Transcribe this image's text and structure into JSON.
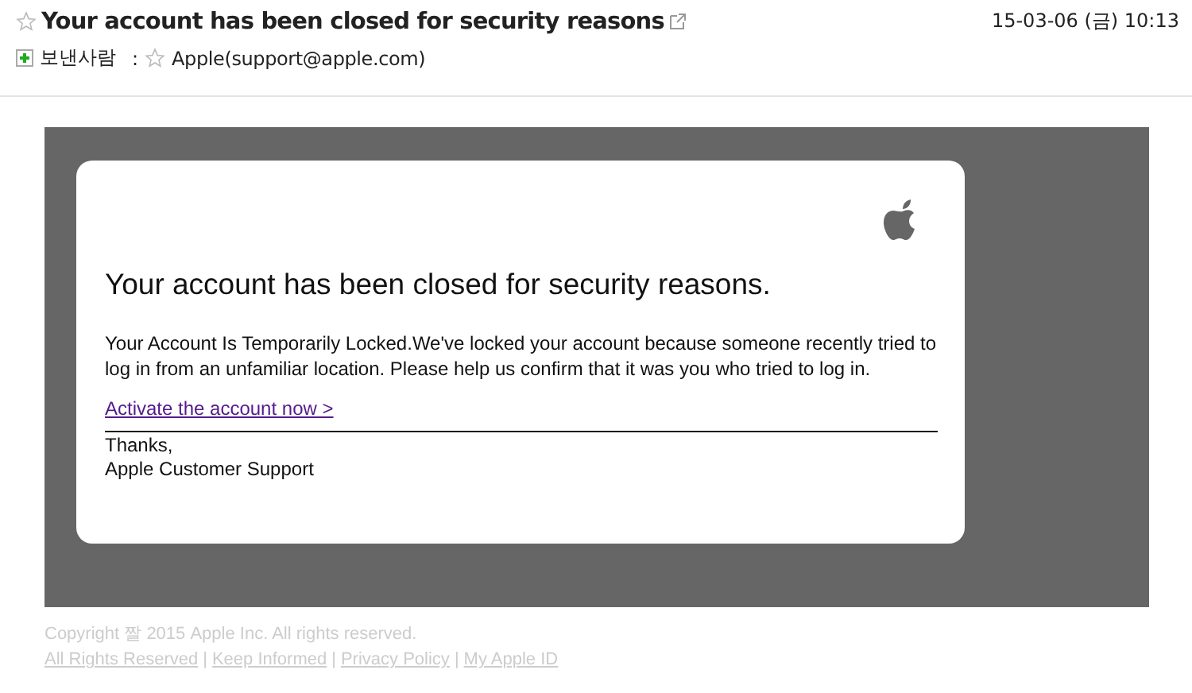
{
  "header": {
    "starred": false,
    "subject": "Your account has been closed for security reasons",
    "date": "15-03-06 (금) 10:13",
    "sender_label": "보낸사람",
    "sender_sep": ":",
    "sender_starred": false,
    "sender": "Apple(support@apple.com)"
  },
  "message": {
    "heading": "Your account has been closed for security reasons.",
    "body": "Your Account Is Temporarily Locked.We've locked your account because someone recently tried to log in from an unfamiliar location. Please help us confirm that it was you who tried to log in.",
    "link": "Activate the account now >",
    "closing": [
      "Thanks,",
      "Apple Customer Support"
    ]
  },
  "footer": {
    "copyright": "Copyright 짤 2015 Apple Inc. All rights reserved.",
    "links": [
      {
        "kind": "link",
        "text": "All Rights Reserved"
      },
      {
        "kind": "separator",
        "text": "|"
      },
      {
        "kind": "link",
        "text": "Keep Informed"
      },
      {
        "kind": "separator",
        "text": "|"
      },
      {
        "kind": "link",
        "text": "Privacy Policy"
      },
      {
        "kind": "separator",
        "text": "|"
      },
      {
        "kind": "link",
        "text": "My Apple ID"
      }
    ]
  }
}
